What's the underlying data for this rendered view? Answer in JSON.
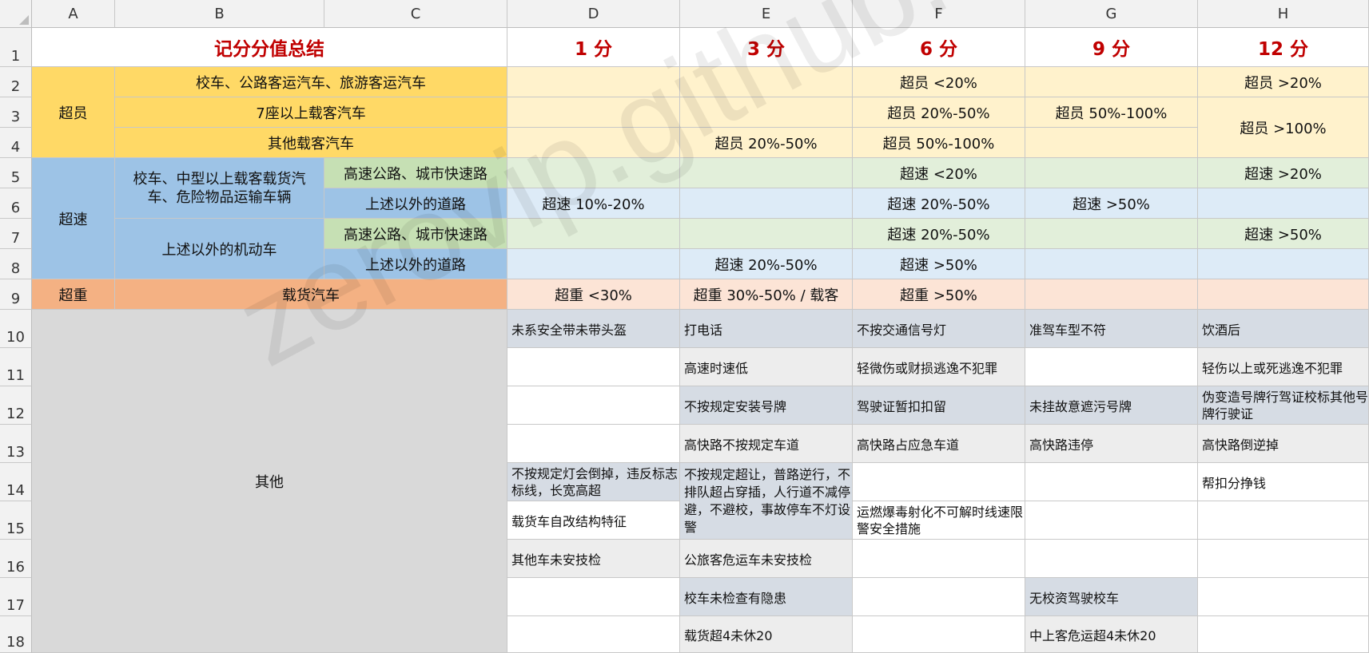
{
  "columns": [
    "A",
    "B",
    "C",
    "D",
    "E",
    "F",
    "G",
    "H"
  ],
  "rows": [
    "1",
    "2",
    "3",
    "4",
    "5",
    "6",
    "7",
    "8",
    "9",
    "10",
    "11",
    "12",
    "13",
    "14",
    "15",
    "16",
    "17",
    "18"
  ],
  "header": {
    "title": "记分分值总结",
    "p1": "1  分",
    "p3": "3  分",
    "p6": "6  分",
    "p9": "9  分",
    "p12": "12  分"
  },
  "overload": {
    "category": "超员",
    "r2": {
      "label": "校车、公路客运汽车、旅游客运汽车",
      "p6": "超员 <20%",
      "p12": "超员 >20%"
    },
    "r3": {
      "label": "7座以上载客汽车",
      "p6": "超员 20%-50%",
      "p9": "超员 50%-100%"
    },
    "r4": {
      "label": "其他载客汽车",
      "p3": "超员 20%-50%",
      "p6": "超员 50%-100%"
    },
    "p12_r34": "超员 >100%"
  },
  "speeding": {
    "category": "超速",
    "vehicle1": "校车、中型以上载客载货汽车、危险物品运输车辆",
    "vehicle2": "上述以外的机动车",
    "r5": {
      "road": "高速公路、城市快速路",
      "p6": "超速 <20%",
      "p12": "超速 >20%"
    },
    "r6": {
      "road": "上述以外的道路",
      "p1": "超速 10%-20%",
      "p6": "超速 20%-50%",
      "p9": "超速 >50%"
    },
    "r7": {
      "road": "高速公路、城市快速路",
      "p6": "超速 20%-50%",
      "p12": "超速 >50%"
    },
    "r8": {
      "road": "上述以外的道路",
      "p3": "超速 20%-50%",
      "p6": "超速 >50%"
    }
  },
  "overweight": {
    "category": "超重",
    "label": "载货汽车",
    "p1": "超重 <30%",
    "p3": "超重 30%-50% / 载客",
    "p6": "超重 >50%"
  },
  "other": {
    "label": "其他",
    "r10": {
      "p1": "未系安全带未带头盔",
      "p3": "打电话",
      "p6": "不按交通信号灯",
      "p9": "准驾车型不符",
      "p12": "饮酒后"
    },
    "r11": {
      "p3": "高速时速低",
      "p6": "轻微伤或财损逃逸不犯罪",
      "p12": "轻伤以上或死逃逸不犯罪"
    },
    "r12": {
      "p3": "不按规定安装号牌",
      "p6": "驾驶证暂扣扣留",
      "p9": "未挂故意遮污号牌",
      "p12": "伪变造号牌行驾证校标其他号牌行驶证"
    },
    "r13": {
      "p3": "高快路不按规定车道",
      "p6": "高快路占应急车道",
      "p9": "高快路违停",
      "p12": "高快路倒逆掉"
    },
    "r14": {
      "p1": "不按规定灯会倒掉，违反标志标线，长宽高超",
      "p12": "帮扣分挣钱"
    },
    "r1415_p3": "不按规定超让，普路逆行，不排队超占穿插，人行道不减停避，不避校，事故停车不灯设警",
    "r15": {
      "p1": "载货车自改结构特征"
    },
    "r1516_p6": "运燃爆毒射化不可解时线速限警安全措施",
    "r16": {
      "p1": "其他车未安技检",
      "p3": "公旅客危运车未安技检"
    },
    "r17": {
      "p3": "校车未检查有隐患",
      "p9": "无校资驾驶校车"
    },
    "r18": {
      "p3": "载货超4未休20",
      "p9": "中上客危运超4未休20"
    }
  },
  "colors": {
    "overload_dark": "#ffd966",
    "overload_light": "#fff2cc",
    "speed_dark": "#9dc3e6",
    "speed_light": "#ddebf7",
    "speed_green": "#c6e0b4",
    "speed_green_light": "#e2efda",
    "weight_dark": "#f4b183",
    "weight_light": "#fce4d6",
    "other_gray": "#d9d9d9",
    "other_blue": "#d6dce4",
    "other_light": "#ededed",
    "title_red": "#c00000"
  },
  "watermark": "zerovip.github.io"
}
